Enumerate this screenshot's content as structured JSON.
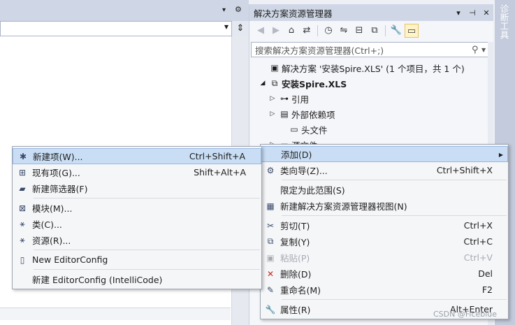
{
  "editor": {
    "pin": "▾",
    "gear": "⚙",
    "split": "⇕"
  },
  "solution_explorer": {
    "title": "解决方案资源管理器",
    "search_placeholder": "搜索解决方案资源管理器(Ctrl+;)",
    "tree": [
      {
        "expander": "",
        "icon": "▣",
        "label": "解决方案 '安装Spire.XLS' (1 个项目，共 1 个)",
        "indent": 12,
        "bold": false
      },
      {
        "expander": "◢",
        "icon": "⧉",
        "label": "安装Spire.XLS",
        "indent": 12,
        "bold": true
      },
      {
        "expander": "▷",
        "icon": "⊶",
        "label": "引用",
        "indent": 26,
        "bold": false
      },
      {
        "expander": "▷",
        "icon": "▤",
        "label": "外部依赖项",
        "indent": 26,
        "bold": false
      },
      {
        "expander": "",
        "icon": "▭",
        "label": "头文件",
        "indent": 40,
        "bold": false
      },
      {
        "expander": "▷",
        "icon": "▭",
        "label": "源文件",
        "indent": 26,
        "bold": false
      }
    ]
  },
  "side_tab": {
    "label": "诊断工具"
  },
  "context_menu": {
    "items": [
      {
        "icon": "",
        "label": "添加(D)",
        "shortcut": "",
        "highlighted": true,
        "submenu": true
      },
      {
        "icon": "⚙",
        "label": "类向导(Z)...",
        "shortcut": "Ctrl+Shift+X"
      },
      {
        "sep": true
      },
      {
        "icon": "",
        "label": "限定为此范围(S)",
        "shortcut": ""
      },
      {
        "icon": "▦",
        "label": "新建解决方案资源管理器视图(N)",
        "shortcut": ""
      },
      {
        "sep": true
      },
      {
        "icon": "✂",
        "label": "剪切(T)",
        "shortcut": "Ctrl+X"
      },
      {
        "icon": "⧉",
        "label": "复制(Y)",
        "shortcut": "Ctrl+C"
      },
      {
        "icon": "▣",
        "label": "粘贴(P)",
        "shortcut": "Ctrl+V",
        "disabled": true
      },
      {
        "icon": "✕",
        "label": "删除(D)",
        "shortcut": "Del",
        "icon_color": "#c42b1c"
      },
      {
        "icon": "✎",
        "label": "重命名(M)",
        "shortcut": "F2"
      },
      {
        "sep": true
      },
      {
        "icon": "🔧",
        "label": "属性(R)",
        "shortcut": "Alt+Enter"
      }
    ]
  },
  "add_submenu": {
    "items": [
      {
        "icon": "✱",
        "label": "新建项(W)...",
        "shortcut": "Ctrl+Shift+A",
        "highlighted": true
      },
      {
        "icon": "⊞",
        "label": "现有项(G)...",
        "shortcut": "Shift+Alt+A"
      },
      {
        "icon": "▰",
        "label": "新建筛选器(F)",
        "shortcut": ""
      },
      {
        "sep": true
      },
      {
        "icon": "⊠",
        "label": "模块(M)...",
        "shortcut": ""
      },
      {
        "icon": "⚹",
        "label": "类(C)...",
        "shortcut": ""
      },
      {
        "icon": "⚹",
        "label": "资源(R)...",
        "shortcut": ""
      },
      {
        "sep": true
      },
      {
        "icon": "▯",
        "label": "New EditorConfig",
        "shortcut": ""
      },
      {
        "sep": true
      },
      {
        "icon": "",
        "label": "新建 EditorConfig (IntelliCode)",
        "shortcut": ""
      }
    ]
  },
  "watermark": "CSDN @Ficeblue"
}
